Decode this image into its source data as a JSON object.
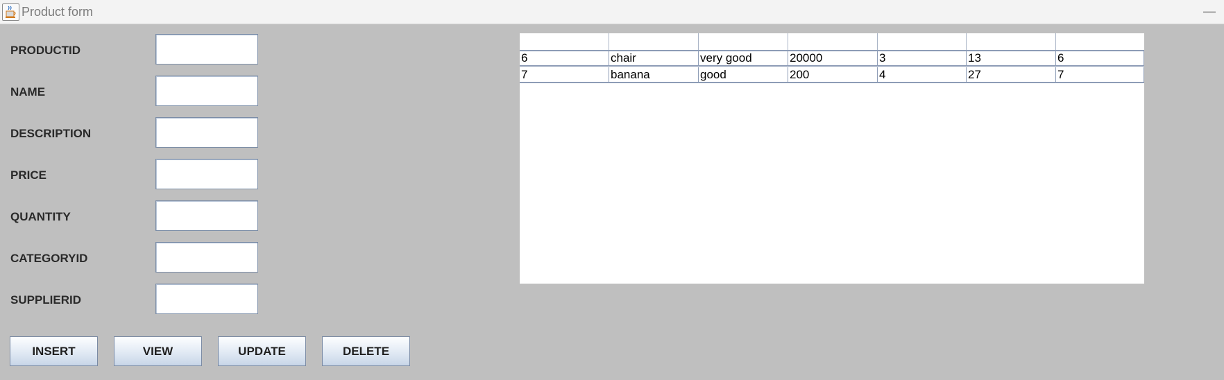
{
  "window": {
    "title": "Product form",
    "minimize_glyph": "—",
    "icon": "java-cup-icon"
  },
  "form": {
    "fields": [
      {
        "label": "PRODUCTID",
        "value": ""
      },
      {
        "label": "NAME",
        "value": ""
      },
      {
        "label": "DESCRIPTION",
        "value": ""
      },
      {
        "label": "PRICE",
        "value": ""
      },
      {
        "label": "QUANTITY",
        "value": ""
      },
      {
        "label": "CATEGORYID",
        "value": ""
      },
      {
        "label": "SUPPLIERID",
        "value": ""
      }
    ]
  },
  "buttons": {
    "insert": "INSERT",
    "view": "VIEW",
    "update": "UPDATE",
    "delete": "DELETE"
  },
  "table": {
    "headers": [
      "",
      "",
      "",
      "",
      "",
      "",
      ""
    ],
    "rows": [
      [
        "6",
        "chair",
        "very good",
        "20000",
        "3",
        "13",
        "6"
      ],
      [
        "7",
        "banana",
        "good",
        "200",
        "4",
        "27",
        "7"
      ]
    ]
  }
}
